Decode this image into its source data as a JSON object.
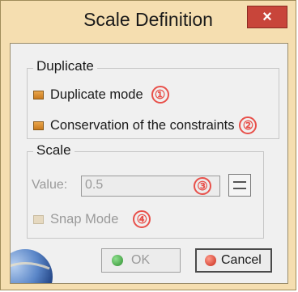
{
  "window": {
    "title": "Scale Definition",
    "close_label": "×"
  },
  "duplicate_group": {
    "label": "Duplicate",
    "duplicate_mode": {
      "label": "Duplicate mode",
      "marker": "①",
      "enabled": true
    },
    "conservation": {
      "label": "Conservation of the constraints",
      "marker": "②",
      "enabled": true
    }
  },
  "scale_group": {
    "label": "Scale",
    "value_label": "Value:",
    "value": "0.5",
    "value_marker": "③",
    "snap_mode": {
      "label": "Snap Mode",
      "marker": "④",
      "enabled": false
    }
  },
  "buttons": {
    "ok": {
      "label": "OK",
      "enabled": false
    },
    "cancel": {
      "label": "Cancel",
      "enabled": true
    }
  },
  "colors": {
    "frame": "#f5deb0",
    "close": "#c8453a",
    "marker": "#e8504a",
    "checkbox": "#e0962f",
    "ok_dot": "#3aa83a",
    "cancel_dot": "#d83a2a"
  },
  "icons": {
    "close": "close-icon",
    "stepper": "stepper-icon",
    "ok": "ok-dot-icon",
    "cancel": "cancel-dot-icon",
    "corner": "globe-icon"
  }
}
